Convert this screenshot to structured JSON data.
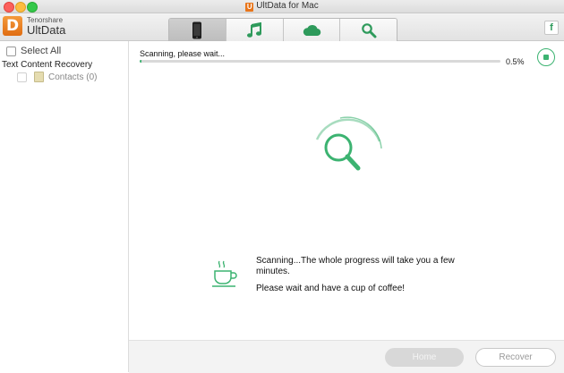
{
  "window": {
    "title": "UltData for Mac",
    "logo_letter": "U"
  },
  "brand": {
    "logo_letter": "D",
    "small": "Tenorshare",
    "name": "UltData"
  },
  "tabs": [
    {
      "name": "device",
      "icon": "phone-icon",
      "active": true
    },
    {
      "name": "itunes",
      "icon": "music-note-icon",
      "active": false
    },
    {
      "name": "icloud",
      "icon": "cloud-icon",
      "active": false
    },
    {
      "name": "repair",
      "icon": "magnifier-wrench-icon",
      "active": false
    }
  ],
  "facebook_letter": "f",
  "sidebar": {
    "select_all": "Select All",
    "category": "Text Content Recovery",
    "items": [
      {
        "label": "Contacts (0)"
      }
    ]
  },
  "scan": {
    "status": "Scanning, please wait...",
    "progress": 0.005,
    "percent_label": "0.5%",
    "message_line1": "Scanning...The whole progress will take you a few minutes.",
    "message_line2": "Please wait and have a cup of coffee!"
  },
  "buttons": {
    "home": "Home",
    "recover": "Recover"
  },
  "colors": {
    "accent": "#3cb371",
    "brand": "#e8751a"
  }
}
